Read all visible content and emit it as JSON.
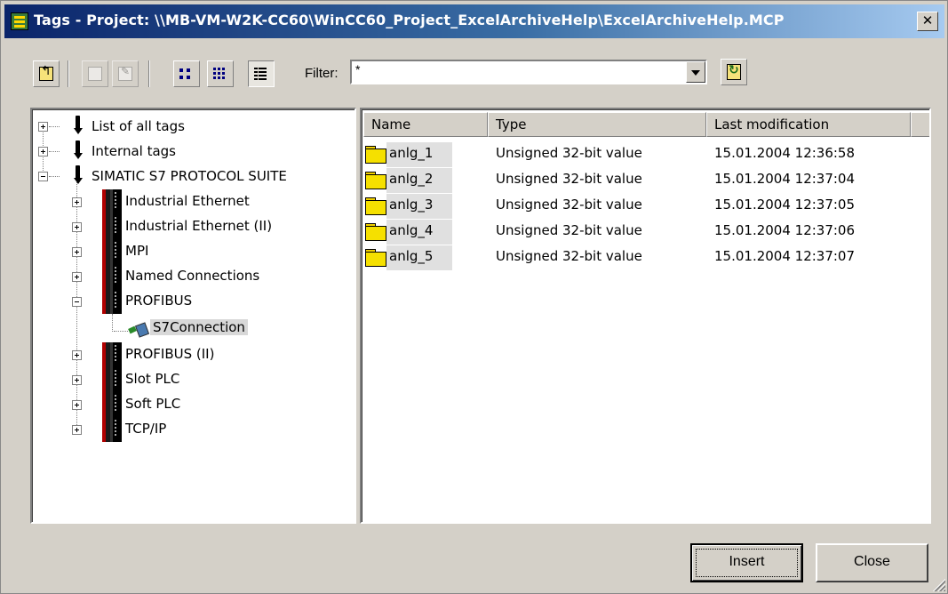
{
  "window": {
    "title": "Tags - Project: \\\\MB-VM-W2K-CC60\\WinCC60_Project_ExcelArchiveHelp\\ExcelArchiveHelp.MCP",
    "close_glyph": "✕"
  },
  "toolbar": {
    "filter_label": "Filter:",
    "filter_value": "*"
  },
  "tree": {
    "items": [
      {
        "label": "List of all tags",
        "icon": "tag-icon",
        "expander": "plus"
      },
      {
        "label": "Internal tags",
        "icon": "tag-icon",
        "expander": "plus"
      },
      {
        "label": "SIMATIC S7 PROTOCOL SUITE",
        "icon": "tag-icon",
        "expander": "minus"
      },
      {
        "label": "Industrial Ethernet",
        "icon": "driver-icon",
        "expander": "plus"
      },
      {
        "label": "Industrial Ethernet (II)",
        "icon": "driver-icon",
        "expander": "plus"
      },
      {
        "label": "MPI",
        "icon": "driver-icon",
        "expander": "plus"
      },
      {
        "label": "Named Connections",
        "icon": "driver-icon",
        "expander": "plus"
      },
      {
        "label": "PROFIBUS",
        "icon": "driver-icon",
        "expander": "minus"
      },
      {
        "label": "S7Connection",
        "icon": "connection-icon",
        "expander": "none",
        "selected": true
      },
      {
        "label": "PROFIBUS (II)",
        "icon": "driver-icon",
        "expander": "plus"
      },
      {
        "label": "Slot PLC",
        "icon": "driver-icon",
        "expander": "plus"
      },
      {
        "label": "Soft PLC",
        "icon": "driver-icon",
        "expander": "plus"
      },
      {
        "label": "TCP/IP",
        "icon": "driver-icon",
        "expander": "plus"
      }
    ]
  },
  "list": {
    "columns": [
      "Name",
      "Type",
      "Last modification"
    ],
    "rows": [
      {
        "name": "anlg_1",
        "type": "Unsigned 32-bit value",
        "modified": "15.01.2004 12:36:58"
      },
      {
        "name": "anlg_2",
        "type": "Unsigned 32-bit value",
        "modified": "15.01.2004 12:37:04"
      },
      {
        "name": "anlg_3",
        "type": "Unsigned 32-bit value",
        "modified": "15.01.2004 12:37:05"
      },
      {
        "name": "anlg_4",
        "type": "Unsigned 32-bit value",
        "modified": "15.01.2004 12:37:06"
      },
      {
        "name": "anlg_5",
        "type": "Unsigned 32-bit value",
        "modified": "15.01.2004 12:37:07"
      }
    ]
  },
  "buttons": {
    "insert": "Insert",
    "close": "Close"
  }
}
